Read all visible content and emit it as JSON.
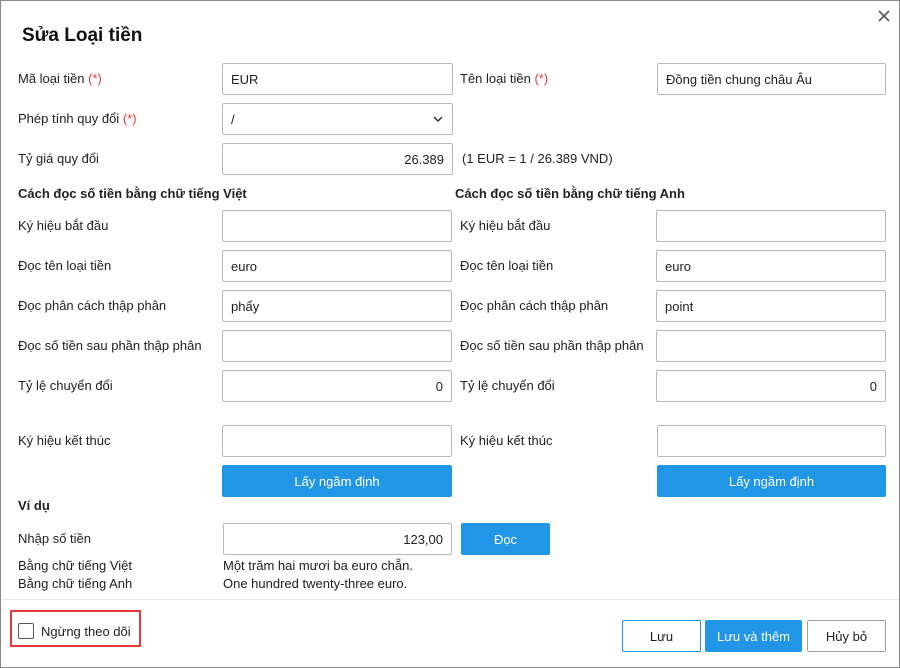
{
  "dialog": {
    "title": "Sửa Loại tiền",
    "required_mark": "(*)"
  },
  "form": {
    "currency_code": {
      "label": "Mã loại tiền",
      "value": "EUR"
    },
    "currency_name": {
      "label": "Tên loại tiền",
      "value": "Đồng tiền chung châu Âu"
    },
    "conversion_op": {
      "label": "Phép tính quy đổi",
      "value": "/"
    },
    "exchange_rate": {
      "label": "Tỷ giá quy đổi",
      "value": "26.389",
      "note": "(1 EUR = 1 / 26.389 VND)"
    }
  },
  "vietnamese": {
    "heading": "Cách đọc số tiền bằng chữ tiếng Việt",
    "start_symbol": {
      "label": "Ký hiệu bắt đầu",
      "value": ""
    },
    "currency_read": {
      "label": "Đọc tên loại tiền",
      "value": "euro"
    },
    "decimal_sep": {
      "label": "Đọc phân cách thập phân",
      "value": "phẩy"
    },
    "after_decimal": {
      "label": "Đọc số tiền sau phần thập phân",
      "value": ""
    },
    "ratio": {
      "label": "Tỷ lệ chuyển đổi",
      "value": "0"
    },
    "end_symbol": {
      "label": "Ký hiệu kết thúc",
      "value": ""
    },
    "default_button": "Lấy ngầm định"
  },
  "english": {
    "heading": "Cách đọc số tiền bằng chữ tiếng Anh",
    "start_symbol": {
      "label": "Ký hiệu bắt đầu",
      "value": ""
    },
    "currency_read": {
      "label": "Đọc tên loại tiền",
      "value": "euro"
    },
    "decimal_sep": {
      "label": "Đọc phân cách thập phân",
      "value": "point"
    },
    "after_decimal": {
      "label": "Đọc số tiền sau phần thập phân",
      "value": ""
    },
    "ratio": {
      "label": "Tỷ lệ chuyển đổi",
      "value": "0"
    },
    "end_symbol": {
      "label": "Ký hiệu kết thúc",
      "value": ""
    },
    "default_button": "Lấy ngầm định"
  },
  "example": {
    "heading": "Ví dụ",
    "amount_label": "Nhập số tiền",
    "amount_value": "123,00",
    "read_button": "Đọc",
    "vi_label": "Bằng chữ tiếng Việt",
    "vi_text": "Một trăm hai mươi ba euro chẵn.",
    "en_label": "Bằng chữ tiếng Anh",
    "en_text": "One hundred twenty-three euro."
  },
  "footer": {
    "stop_tracking": "Ngừng theo dõi",
    "save": "Lưu",
    "save_and_add": "Lưu và thêm",
    "cancel": "Hủy bỏ"
  },
  "icons": {
    "close": "close-icon",
    "dropdown": "chevron-down-icon",
    "checkbox": "checkbox-unchecked"
  },
  "colors": {
    "accent": "#2196e6",
    "required": "#e53935",
    "highlight_border": "#e53935"
  }
}
